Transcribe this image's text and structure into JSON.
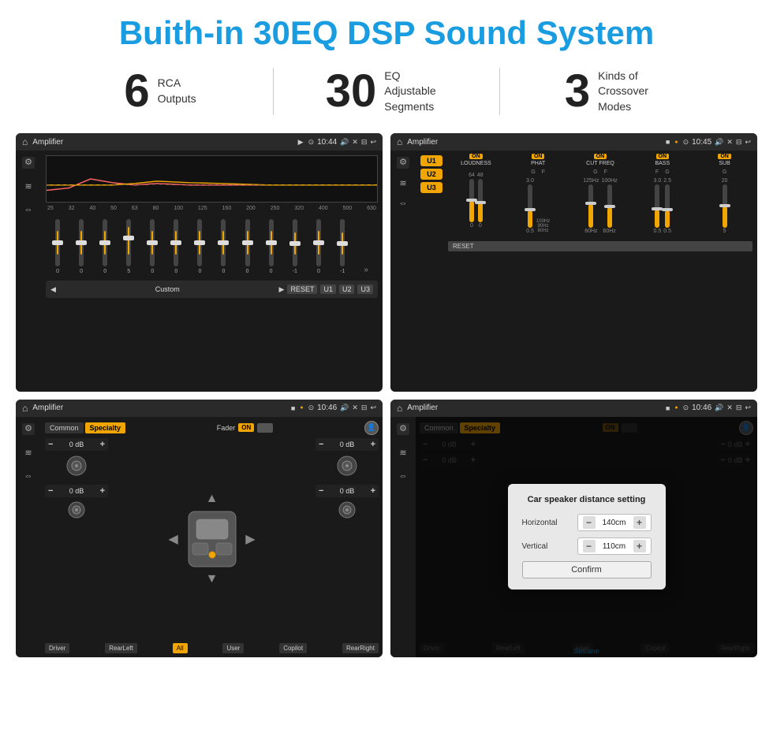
{
  "header": {
    "title": "Buith-in 30EQ DSP Sound System"
  },
  "stats": [
    {
      "number": "6",
      "text_line1": "RCA",
      "text_line2": "Outputs"
    },
    {
      "number": "30",
      "text_line1": "EQ Adjustable",
      "text_line2": "Segments"
    },
    {
      "number": "3",
      "text_line1": "Kinds of",
      "text_line2": "Crossover Modes"
    }
  ],
  "screens": {
    "top_left": {
      "title": "Amplifier",
      "time": "10:44",
      "freq_labels": [
        "25",
        "32",
        "40",
        "50",
        "63",
        "80",
        "100",
        "125",
        "160",
        "200",
        "250",
        "320",
        "400",
        "500",
        "630"
      ],
      "eq_values": [
        "0",
        "0",
        "0",
        "5",
        "0",
        "0",
        "0",
        "0",
        "0",
        "0",
        "-1",
        "0",
        "-1"
      ],
      "presets": [
        "Custom",
        "RESET",
        "U1",
        "U2",
        "U3"
      ]
    },
    "top_right": {
      "title": "Amplifier",
      "time": "10:45",
      "presets": [
        "U1",
        "U2",
        "U3"
      ],
      "controls": [
        {
          "label": "LOUDNESS",
          "on": true,
          "subG": "",
          "subF": ""
        },
        {
          "label": "PHAT",
          "on": true,
          "subG": "G",
          "subF": "F"
        },
        {
          "label": "CUT FREQ",
          "on": true,
          "subG": "G",
          "subF": "F"
        },
        {
          "label": "BASS",
          "on": true,
          "subG": "F",
          "subF": "G"
        },
        {
          "label": "SUB",
          "on": true,
          "subG": "G",
          "subF": ""
        }
      ],
      "reset_label": "RESET"
    },
    "bottom_left": {
      "title": "Amplifier",
      "time": "10:46",
      "tabs": [
        "Common",
        "Specialty"
      ],
      "active_tab": "Specialty",
      "fader_label": "Fader",
      "fader_on": true,
      "db_values": [
        "0 dB",
        "0 dB",
        "0 dB",
        "0 dB"
      ],
      "buttons": [
        "Driver",
        "RearLeft",
        "All",
        "User",
        "Copilot",
        "RearRight"
      ]
    },
    "bottom_right": {
      "title": "Amplifier",
      "time": "10:46",
      "tabs": [
        "Common",
        "Specialty"
      ],
      "active_tab": "Specialty",
      "dialog": {
        "title": "Car speaker distance setting",
        "horizontal_label": "Horizontal",
        "horizontal_value": "140cm",
        "vertical_label": "Vertical",
        "vertical_value": "110cm",
        "confirm_label": "Confirm"
      },
      "buttons": [
        "Driver",
        "RearLeft",
        "All",
        "User",
        "Copilot",
        "RearRight"
      ]
    }
  },
  "watermark": "Seicane"
}
